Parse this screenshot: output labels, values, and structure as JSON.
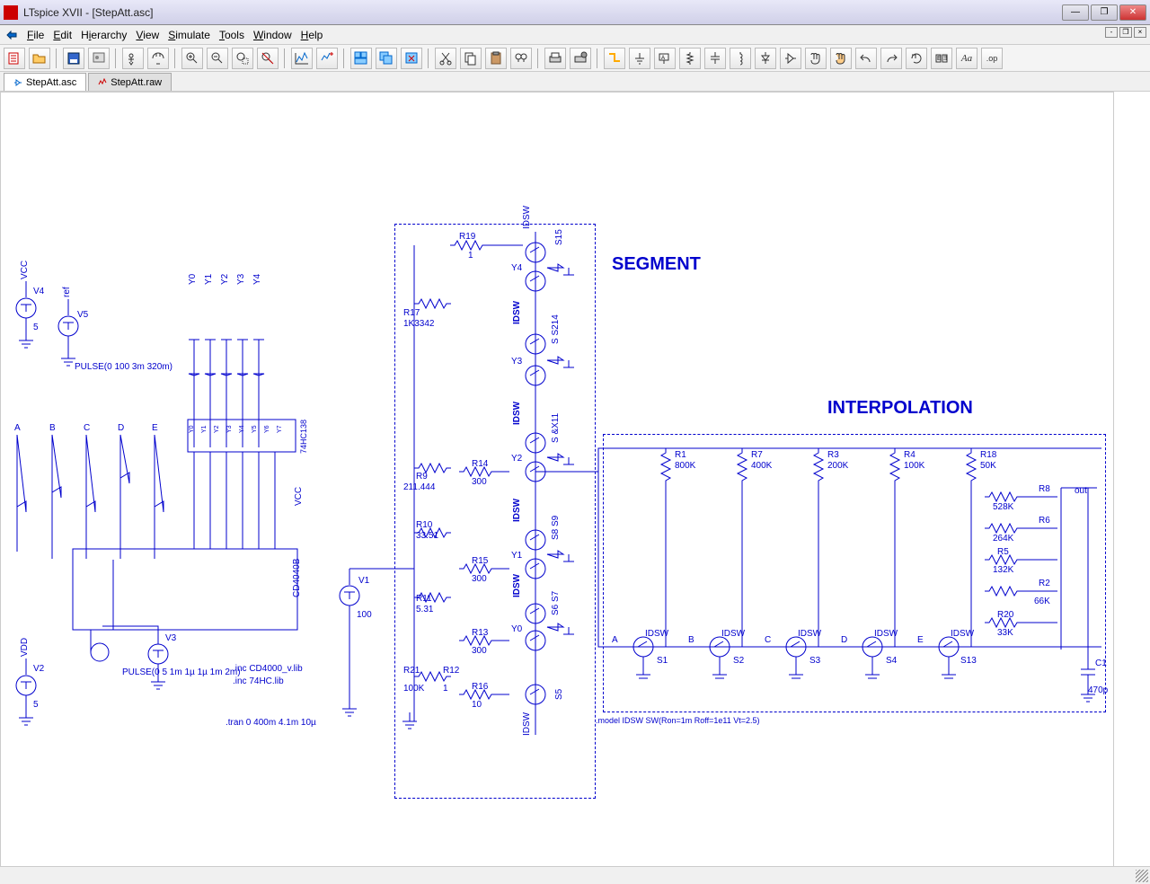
{
  "window": {
    "title": "LTspice XVII - [StepAtt.asc]"
  },
  "menu": {
    "items": [
      "File",
      "Edit",
      "Hierarchy",
      "View",
      "Simulate",
      "Tools",
      "Window",
      "Help"
    ]
  },
  "tabs": [
    {
      "label": "StepAtt.asc",
      "active": true
    },
    {
      "label": "StepAtt.raw",
      "active": false
    }
  ],
  "schematic": {
    "section_segment": "SEGMENT",
    "section_interpolation": "INTERPOLATION",
    "sources": {
      "V4": {
        "name": "V4",
        "val": "5",
        "net": "VCC"
      },
      "V5": {
        "name": "V5",
        "val": "PULSE(0 100 3m 320m)",
        "net": "ref"
      },
      "V3": {
        "name": "V3",
        "val": "PULSE(0 5 1m 1µ 1µ 1m 2m)"
      },
      "V2": {
        "name": "V2",
        "val": "5",
        "net": "VDD"
      },
      "V1": {
        "name": "V1",
        "val": "100"
      }
    },
    "chips": {
      "u1": "CD4040B",
      "u2": "74HC138"
    },
    "netlabels": {
      "vcc": "VCC",
      "ref": "ref",
      "vdd": "VDD",
      "out": "out"
    },
    "y_labels": [
      "Y0",
      "Y1",
      "Y2",
      "Y3",
      "Y4"
    ],
    "pins_138": [
      "Y0",
      "Y1",
      "Y2",
      "Y3",
      "Y4",
      "Y5",
      "Y6",
      "Y7"
    ],
    "abc": [
      "A",
      "B",
      "C",
      "D",
      "E"
    ],
    "segment_r": {
      "R19": {
        "n": "R19",
        "v": "1"
      },
      "R17": {
        "n": "R17",
        "v": "1K3342"
      },
      "R9": {
        "n": "R9",
        "v": "211.444"
      },
      "R14": {
        "n": "R14",
        "v": "300"
      },
      "R10": {
        "n": "R10",
        "v": "33.51"
      },
      "R15": {
        "n": "R15",
        "v": "300"
      },
      "R11": {
        "n": "R11",
        "v": "5.31"
      },
      "R13": {
        "n": "R13",
        "v": "300"
      },
      "R21": {
        "n": "R21",
        "v": "100K"
      },
      "R12": {
        "n": "R12",
        "v": "1"
      },
      "R16": {
        "n": "R16",
        "v": "10"
      }
    },
    "segment_sw": {
      "S15": "S15",
      "S14": "S S214",
      "S10": "S &X11",
      "S8": "S8 S9",
      "S6": "S6 S7",
      "S5": "S5",
      "idsw": "IDSW",
      "Y4": "Y4",
      "Y3": "Y3",
      "Y2": "Y2",
      "Y1": "Y1",
      "Y0": "Y0"
    },
    "interp_r_top": {
      "R1": {
        "n": "R1",
        "v": "800K"
      },
      "R7": {
        "n": "R7",
        "v": "400K"
      },
      "R3": {
        "n": "R3",
        "v": "200K"
      },
      "R4": {
        "n": "R4",
        "v": "100K"
      },
      "R18": {
        "n": "R18",
        "v": "50K"
      }
    },
    "interp_r_right": {
      "R8": {
        "n": "R8",
        "v": "528K"
      },
      "R6": {
        "n": "R6",
        "v": "264K"
      },
      "R5": {
        "n": "R5",
        "v": "132K"
      },
      "R2": {
        "n": "R2",
        "v": "66K"
      },
      "R20": {
        "n": "R20",
        "v": "33K"
      }
    },
    "interp_sw": {
      "S1": "S1",
      "S2": "S2",
      "S3": "S3",
      "S4": "S4",
      "S13": "S13"
    },
    "cap": {
      "n": "C1",
      "v": "470p"
    },
    "directives": {
      "inc1": ".inc CD4000_v.lib",
      "inc2": ".inc 74HC.lib",
      "tran": ".tran 0 400m 4.1m 10µ",
      "model": ".model IDSW SW(Ron=1m Roff=1e11 Vt=2.5)"
    }
  }
}
